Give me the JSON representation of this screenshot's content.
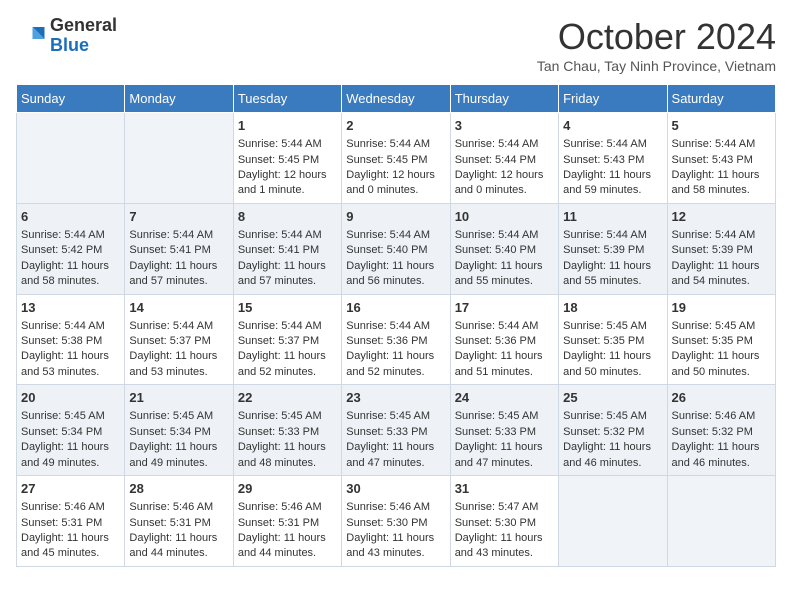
{
  "header": {
    "logo_general": "General",
    "logo_blue": "Blue",
    "month_title": "October 2024",
    "subtitle": "Tan Chau, Tay Ninh Province, Vietnam"
  },
  "days_of_week": [
    "Sunday",
    "Monday",
    "Tuesday",
    "Wednesday",
    "Thursday",
    "Friday",
    "Saturday"
  ],
  "weeks": [
    [
      {
        "day": "",
        "sunrise": "",
        "sunset": "",
        "daylight": ""
      },
      {
        "day": "",
        "sunrise": "",
        "sunset": "",
        "daylight": ""
      },
      {
        "day": "1",
        "sunrise": "Sunrise: 5:44 AM",
        "sunset": "Sunset: 5:45 PM",
        "daylight": "Daylight: 12 hours and 1 minute."
      },
      {
        "day": "2",
        "sunrise": "Sunrise: 5:44 AM",
        "sunset": "Sunset: 5:45 PM",
        "daylight": "Daylight: 12 hours and 0 minutes."
      },
      {
        "day": "3",
        "sunrise": "Sunrise: 5:44 AM",
        "sunset": "Sunset: 5:44 PM",
        "daylight": "Daylight: 12 hours and 0 minutes."
      },
      {
        "day": "4",
        "sunrise": "Sunrise: 5:44 AM",
        "sunset": "Sunset: 5:43 PM",
        "daylight": "Daylight: 11 hours and 59 minutes."
      },
      {
        "day": "5",
        "sunrise": "Sunrise: 5:44 AM",
        "sunset": "Sunset: 5:43 PM",
        "daylight": "Daylight: 11 hours and 58 minutes."
      }
    ],
    [
      {
        "day": "6",
        "sunrise": "Sunrise: 5:44 AM",
        "sunset": "Sunset: 5:42 PM",
        "daylight": "Daylight: 11 hours and 58 minutes."
      },
      {
        "day": "7",
        "sunrise": "Sunrise: 5:44 AM",
        "sunset": "Sunset: 5:41 PM",
        "daylight": "Daylight: 11 hours and 57 minutes."
      },
      {
        "day": "8",
        "sunrise": "Sunrise: 5:44 AM",
        "sunset": "Sunset: 5:41 PM",
        "daylight": "Daylight: 11 hours and 57 minutes."
      },
      {
        "day": "9",
        "sunrise": "Sunrise: 5:44 AM",
        "sunset": "Sunset: 5:40 PM",
        "daylight": "Daylight: 11 hours and 56 minutes."
      },
      {
        "day": "10",
        "sunrise": "Sunrise: 5:44 AM",
        "sunset": "Sunset: 5:40 PM",
        "daylight": "Daylight: 11 hours and 55 minutes."
      },
      {
        "day": "11",
        "sunrise": "Sunrise: 5:44 AM",
        "sunset": "Sunset: 5:39 PM",
        "daylight": "Daylight: 11 hours and 55 minutes."
      },
      {
        "day": "12",
        "sunrise": "Sunrise: 5:44 AM",
        "sunset": "Sunset: 5:39 PM",
        "daylight": "Daylight: 11 hours and 54 minutes."
      }
    ],
    [
      {
        "day": "13",
        "sunrise": "Sunrise: 5:44 AM",
        "sunset": "Sunset: 5:38 PM",
        "daylight": "Daylight: 11 hours and 53 minutes."
      },
      {
        "day": "14",
        "sunrise": "Sunrise: 5:44 AM",
        "sunset": "Sunset: 5:37 PM",
        "daylight": "Daylight: 11 hours and 53 minutes."
      },
      {
        "day": "15",
        "sunrise": "Sunrise: 5:44 AM",
        "sunset": "Sunset: 5:37 PM",
        "daylight": "Daylight: 11 hours and 52 minutes."
      },
      {
        "day": "16",
        "sunrise": "Sunrise: 5:44 AM",
        "sunset": "Sunset: 5:36 PM",
        "daylight": "Daylight: 11 hours and 52 minutes."
      },
      {
        "day": "17",
        "sunrise": "Sunrise: 5:44 AM",
        "sunset": "Sunset: 5:36 PM",
        "daylight": "Daylight: 11 hours and 51 minutes."
      },
      {
        "day": "18",
        "sunrise": "Sunrise: 5:45 AM",
        "sunset": "Sunset: 5:35 PM",
        "daylight": "Daylight: 11 hours and 50 minutes."
      },
      {
        "day": "19",
        "sunrise": "Sunrise: 5:45 AM",
        "sunset": "Sunset: 5:35 PM",
        "daylight": "Daylight: 11 hours and 50 minutes."
      }
    ],
    [
      {
        "day": "20",
        "sunrise": "Sunrise: 5:45 AM",
        "sunset": "Sunset: 5:34 PM",
        "daylight": "Daylight: 11 hours and 49 minutes."
      },
      {
        "day": "21",
        "sunrise": "Sunrise: 5:45 AM",
        "sunset": "Sunset: 5:34 PM",
        "daylight": "Daylight: 11 hours and 49 minutes."
      },
      {
        "day": "22",
        "sunrise": "Sunrise: 5:45 AM",
        "sunset": "Sunset: 5:33 PM",
        "daylight": "Daylight: 11 hours and 48 minutes."
      },
      {
        "day": "23",
        "sunrise": "Sunrise: 5:45 AM",
        "sunset": "Sunset: 5:33 PM",
        "daylight": "Daylight: 11 hours and 47 minutes."
      },
      {
        "day": "24",
        "sunrise": "Sunrise: 5:45 AM",
        "sunset": "Sunset: 5:33 PM",
        "daylight": "Daylight: 11 hours and 47 minutes."
      },
      {
        "day": "25",
        "sunrise": "Sunrise: 5:45 AM",
        "sunset": "Sunset: 5:32 PM",
        "daylight": "Daylight: 11 hours and 46 minutes."
      },
      {
        "day": "26",
        "sunrise": "Sunrise: 5:46 AM",
        "sunset": "Sunset: 5:32 PM",
        "daylight": "Daylight: 11 hours and 46 minutes."
      }
    ],
    [
      {
        "day": "27",
        "sunrise": "Sunrise: 5:46 AM",
        "sunset": "Sunset: 5:31 PM",
        "daylight": "Daylight: 11 hours and 45 minutes."
      },
      {
        "day": "28",
        "sunrise": "Sunrise: 5:46 AM",
        "sunset": "Sunset: 5:31 PM",
        "daylight": "Daylight: 11 hours and 44 minutes."
      },
      {
        "day": "29",
        "sunrise": "Sunrise: 5:46 AM",
        "sunset": "Sunset: 5:31 PM",
        "daylight": "Daylight: 11 hours and 44 minutes."
      },
      {
        "day": "30",
        "sunrise": "Sunrise: 5:46 AM",
        "sunset": "Sunset: 5:30 PM",
        "daylight": "Daylight: 11 hours and 43 minutes."
      },
      {
        "day": "31",
        "sunrise": "Sunrise: 5:47 AM",
        "sunset": "Sunset: 5:30 PM",
        "daylight": "Daylight: 11 hours and 43 minutes."
      },
      {
        "day": "",
        "sunrise": "",
        "sunset": "",
        "daylight": ""
      },
      {
        "day": "",
        "sunrise": "",
        "sunset": "",
        "daylight": ""
      }
    ]
  ]
}
